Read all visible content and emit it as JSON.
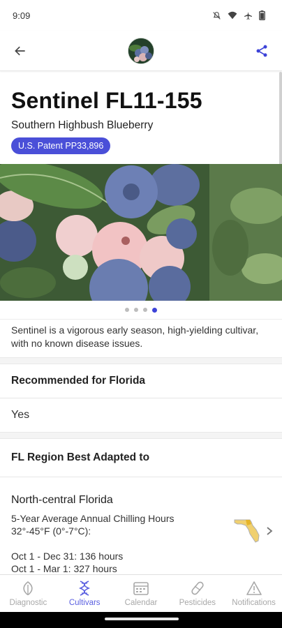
{
  "status": {
    "time": "9:09"
  },
  "app_bar": {
    "back_icon": "arrow-back-icon",
    "avatar": "blueberry-avatar",
    "share_icon": "share-icon",
    "accent": "#3d43d8"
  },
  "cultivar": {
    "name": "Sentinel FL11-155",
    "type": "Southern Highbush Blueberry",
    "patent": "U.S. Patent PP33,896",
    "badge_color": "#4a4fd8",
    "carousel": {
      "count": 4,
      "active_index": 3
    },
    "description": "Sentinel is a vigorous early season, high-yielding cultivar, with no known disease issues."
  },
  "recommended": {
    "title": "Recommended for Florida",
    "value": "Yes"
  },
  "region": {
    "title": "FL Region Best Adapted to",
    "name": "North-central Florida",
    "chill_label_1": "5-Year Average Annual Chilling Hours",
    "chill_label_2": "32°-45°F (0°-7°C):",
    "line_1": "Oct 1 - Dec 31: 136 hours",
    "line_2": "Oct 1 - Mar 1: 327 hours"
  },
  "nav": {
    "items": [
      {
        "label": "Diagnostic",
        "icon": "leaf-icon"
      },
      {
        "label": "Cultivars",
        "icon": "dna-icon"
      },
      {
        "label": "Calendar",
        "icon": "calendar-icon"
      },
      {
        "label": "Pesticides",
        "icon": "pill-icon"
      },
      {
        "label": "Notifications",
        "icon": "warning-icon"
      }
    ],
    "active_index": 1,
    "active_color": "#5a5fe0"
  }
}
